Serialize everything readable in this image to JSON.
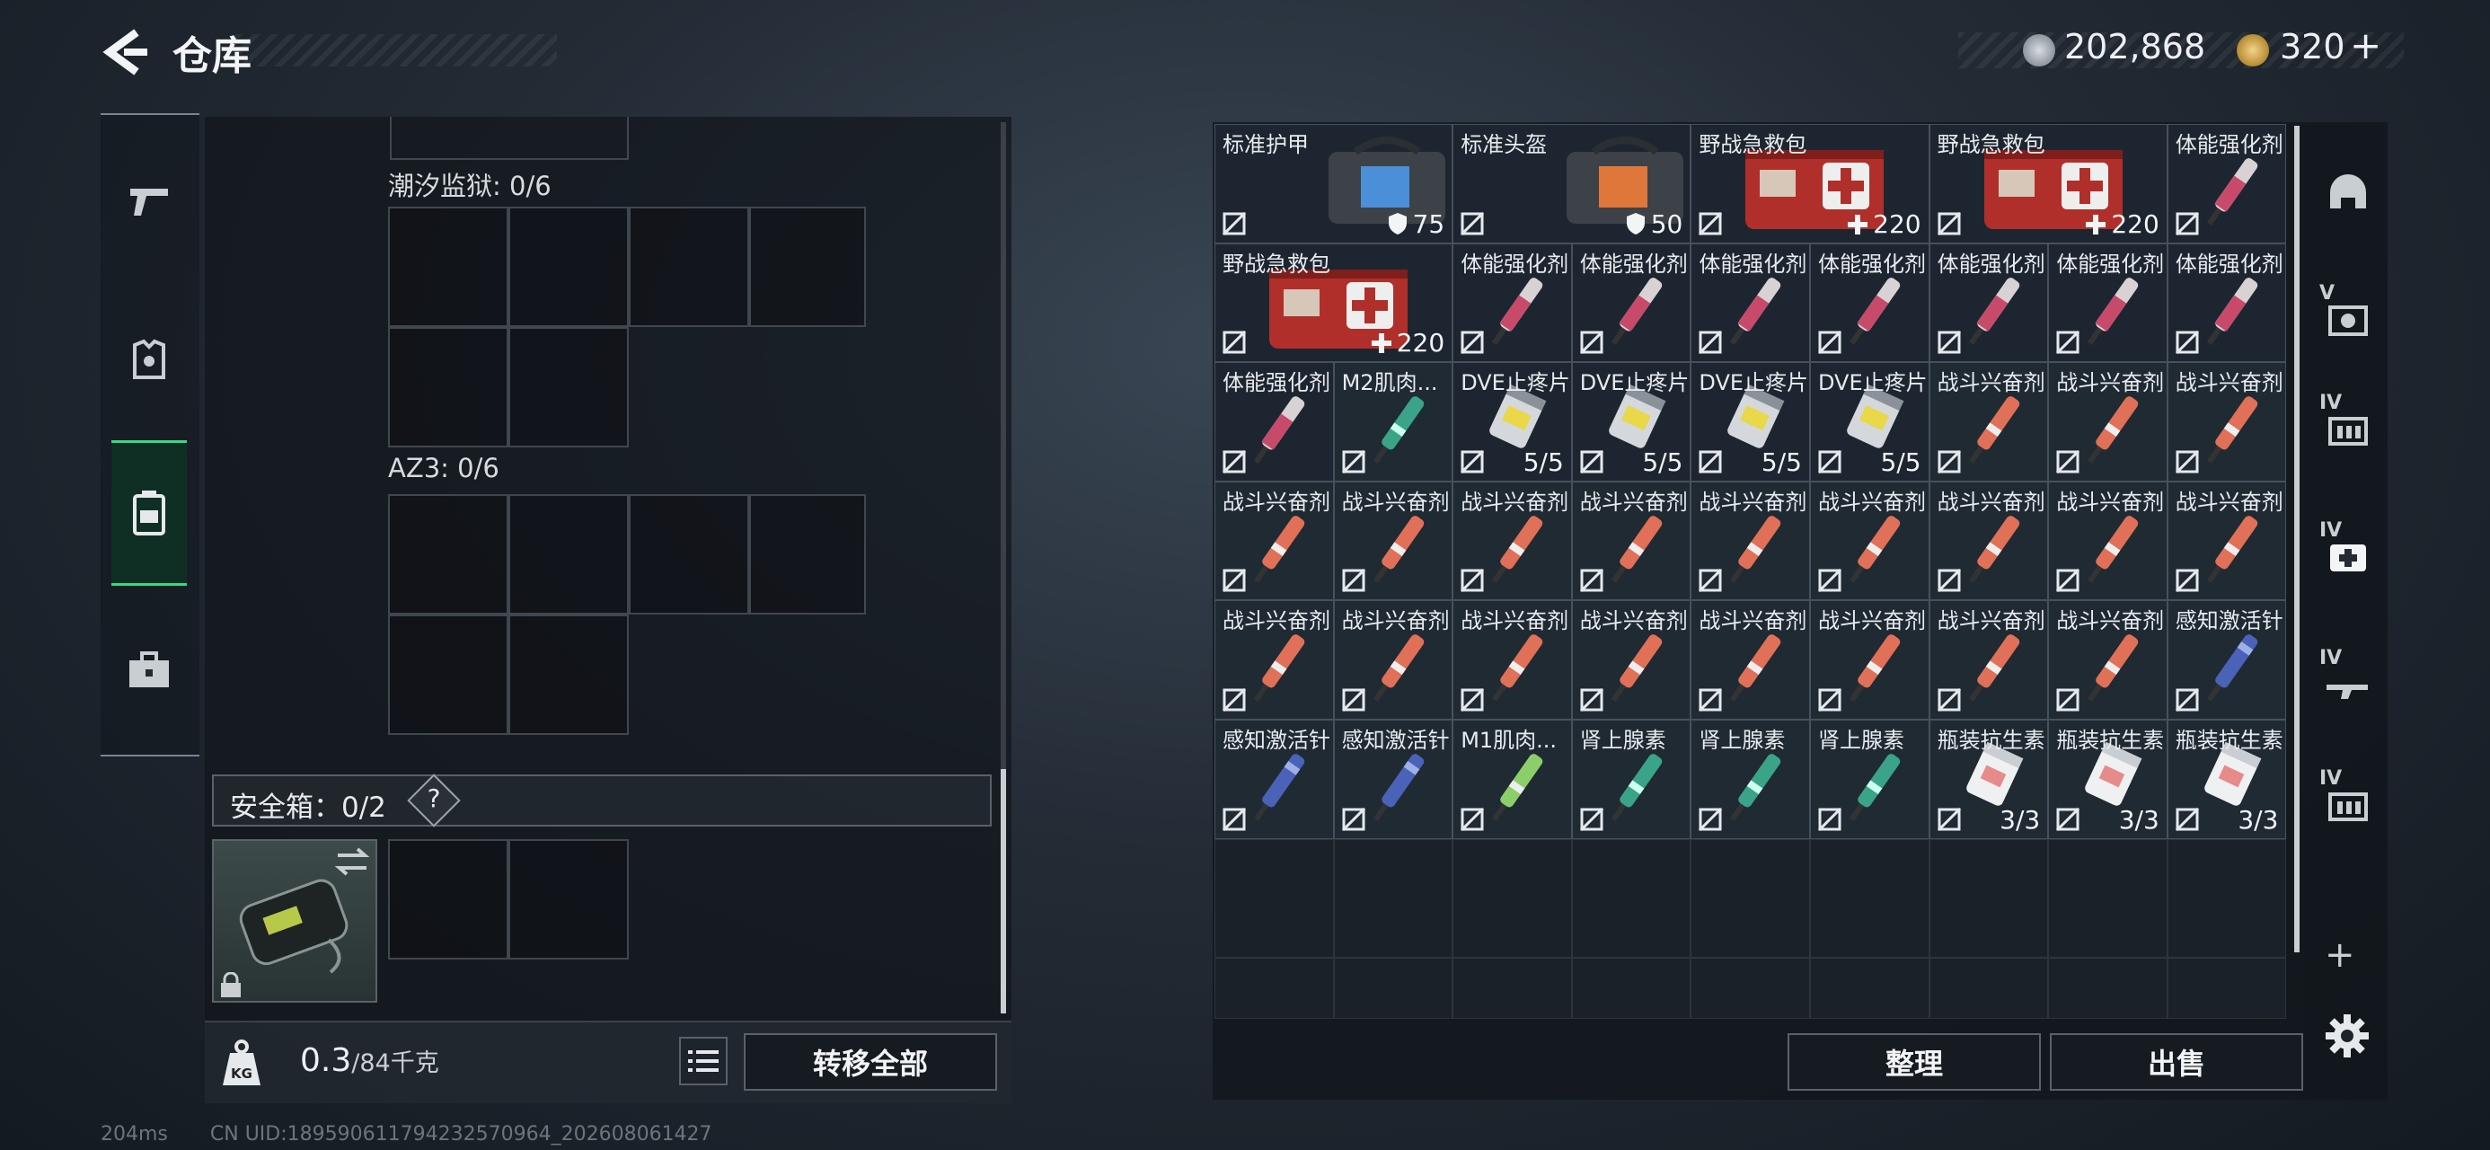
{
  "header": {
    "title": "仓库",
    "back_icon": "chevron-left-icon"
  },
  "currency": {
    "silver": {
      "icon": "silver-coin-icon",
      "value": "202,868"
    },
    "gold": {
      "icon": "gold-coin-icon",
      "value": "320",
      "add_label": "+"
    }
  },
  "left_nav": [
    {
      "icon": "pistol-icon",
      "active": false
    },
    {
      "icon": "armor-vest-icon",
      "active": false
    },
    {
      "icon": "backpack-icon",
      "active": true
    },
    {
      "icon": "briefcase-icon",
      "active": false
    }
  ],
  "containers": [
    {
      "label": "潮汐监狱: 0/6"
    },
    {
      "label": "AZ3: 0/6"
    }
  ],
  "safe_box": {
    "label": "安全箱：0/2",
    "help": "?",
    "swap_icon": "swap-icon",
    "lock_icon": "lock-icon"
  },
  "weight": {
    "value": "0.3",
    "capacity": "/84千克",
    "kg_icon": "kg-weight-icon"
  },
  "buttons": {
    "transfer_all": "转移全部",
    "sort": "整理",
    "sell": "出售"
  },
  "right_side": [
    {
      "tag": "",
      "icon": "helmet-icon"
    },
    {
      "tag": "V",
      "icon": "armor-plate-icon"
    },
    {
      "tag": "IV",
      "icon": "ammo-box-icon"
    },
    {
      "tag": "IV",
      "icon": "medkit-icon"
    },
    {
      "tag": "IV",
      "icon": "rifle-icon"
    },
    {
      "tag": "IV",
      "icon": "ammo-box-icon"
    }
  ],
  "add_icon": "plus-icon",
  "settings_icon": "gear-icon",
  "items": [
    {
      "name": "标准护甲",
      "kind": "bag",
      "tint": "blue",
      "count": "75",
      "stat_icon": "shield-icon"
    },
    {
      "name": "标准头盔",
      "kind": "bag",
      "tint": "orange",
      "count": "50",
      "stat_icon": "shield-icon"
    },
    {
      "name": "野战急救包",
      "kind": "medkit",
      "count": "220",
      "stat_icon": "plus-icon"
    },
    {
      "name": "野战急救包",
      "kind": "medkit",
      "count": "220",
      "stat_icon": "plus-icon"
    },
    {
      "name": "野战急救包",
      "kind": "medkit",
      "count": "220",
      "stat_icon": "plus-icon"
    },
    {
      "name": "体能强化剂",
      "kind": "pink"
    },
    {
      "name": "体能强化剂",
      "kind": "pink"
    },
    {
      "name": "体能强化剂",
      "kind": "pink"
    },
    {
      "name": "体能强化剂",
      "kind": "pink"
    },
    {
      "name": "体能强化剂",
      "kind": "pink"
    },
    {
      "name": "体能强化剂",
      "kind": "pink"
    },
    {
      "name": "体能强化剂",
      "kind": "pink"
    },
    {
      "name": "体能强化剂",
      "kind": "pink"
    },
    {
      "name": "体能强化剂",
      "kind": "pink"
    },
    {
      "name": "M2肌肉...",
      "kind": "teal"
    },
    {
      "name": "DVE止疼片",
      "kind": "bottle",
      "count": "5/5"
    },
    {
      "name": "DVE止疼片",
      "kind": "bottle",
      "count": "5/5"
    },
    {
      "name": "DVE止疼片",
      "kind": "bottle",
      "count": "5/5"
    },
    {
      "name": "DVE止疼片",
      "kind": "bottle",
      "count": "5/5"
    },
    {
      "name": "战斗兴奋剂",
      "kind": "red"
    },
    {
      "name": "战斗兴奋剂",
      "kind": "red"
    },
    {
      "name": "战斗兴奋剂",
      "kind": "red"
    },
    {
      "name": "战斗兴奋剂",
      "kind": "red"
    },
    {
      "name": "战斗兴奋剂",
      "kind": "red"
    },
    {
      "name": "战斗兴奋剂",
      "kind": "red"
    },
    {
      "name": "战斗兴奋剂",
      "kind": "red"
    },
    {
      "name": "战斗兴奋剂",
      "kind": "red"
    },
    {
      "name": "战斗兴奋剂",
      "kind": "red"
    },
    {
      "name": "战斗兴奋剂",
      "kind": "red"
    },
    {
      "name": "战斗兴奋剂",
      "kind": "red"
    },
    {
      "name": "战斗兴奋剂",
      "kind": "red"
    },
    {
      "name": "战斗兴奋剂",
      "kind": "red"
    },
    {
      "name": "战斗兴奋剂",
      "kind": "red"
    },
    {
      "name": "战斗兴奋剂",
      "kind": "red"
    },
    {
      "name": "战斗兴奋剂",
      "kind": "red"
    },
    {
      "name": "战斗兴奋剂",
      "kind": "red"
    },
    {
      "name": "战斗兴奋剂",
      "kind": "red"
    },
    {
      "name": "战斗兴奋剂",
      "kind": "red"
    },
    {
      "name": "战斗兴奋剂",
      "kind": "red"
    },
    {
      "name": "感知激活针",
      "kind": "blue"
    },
    {
      "name": "感知激活针",
      "kind": "blue"
    },
    {
      "name": "感知激活针",
      "kind": "blue"
    },
    {
      "name": "M1肌肉...",
      "kind": "green"
    },
    {
      "name": "肾上腺素",
      "kind": "teal"
    },
    {
      "name": "肾上腺素",
      "kind": "teal"
    },
    {
      "name": "肾上腺素",
      "kind": "teal"
    },
    {
      "name": "瓶装抗生素",
      "kind": "pill",
      "count": "3/3"
    },
    {
      "name": "瓶装抗生素",
      "kind": "pill",
      "count": "3/3"
    },
    {
      "name": "瓶装抗生素",
      "kind": "pill",
      "count": "3/3"
    }
  ],
  "status": {
    "ping": "204ms",
    "uid": "CN UID:1895906117942325709​64_202608061427"
  }
}
